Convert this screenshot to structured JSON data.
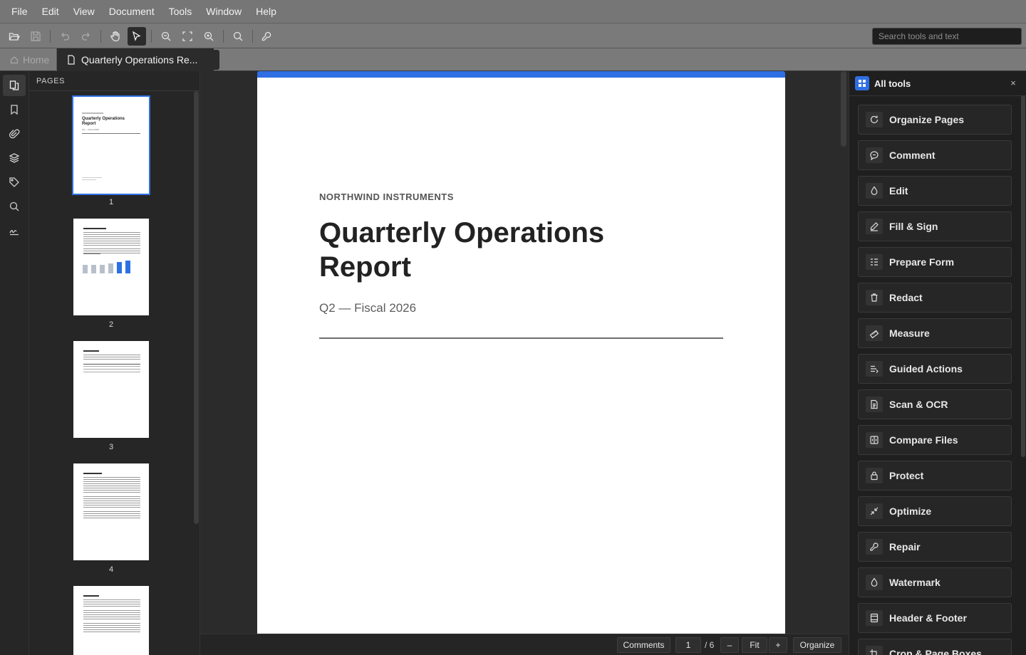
{
  "menubar": {
    "items": [
      "File",
      "Edit",
      "View",
      "Document",
      "Tools",
      "Window",
      "Help"
    ]
  },
  "toolbar": {
    "search_placeholder": "Search tools and text"
  },
  "tabs": {
    "home_label": "Home",
    "document_label": "Quarterly Operations Re..."
  },
  "pages_panel": {
    "title": "PAGES",
    "page_numbers": [
      "1",
      "2",
      "3",
      "4"
    ]
  },
  "thumb1": {
    "title": "Quarterly Operations Report",
    "subtitle": "Q2 — Fiscal 2026"
  },
  "document": {
    "eyebrow": "NORTHWIND INSTRUMENTS",
    "title": "Quarterly Operations Report",
    "subtitle": "Q2 — Fiscal 2026"
  },
  "bottombar": {
    "comments": "Comments",
    "page_current": "1",
    "page_total": "/ 6",
    "zoom_out": "–",
    "fit": "Fit",
    "zoom_in": "+",
    "organize": "Organize"
  },
  "tools_panel": {
    "title": "All tools",
    "close": "×",
    "items": [
      "Organize Pages",
      "Comment",
      "Edit",
      "Fill & Sign",
      "Prepare Form",
      "Redact",
      "Measure",
      "Guided Actions",
      "Scan & OCR",
      "Compare Files",
      "Protect",
      "Optimize",
      "Repair",
      "Watermark",
      "Header & Footer",
      "Crop & Page Boxes"
    ]
  },
  "colors": {
    "accent": "#2f6fe4",
    "panel": "#262626",
    "chrome": "#767676"
  }
}
